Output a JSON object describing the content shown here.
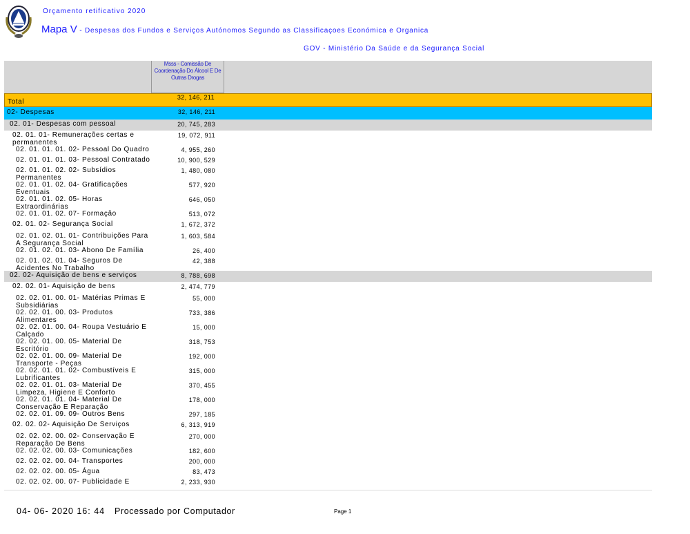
{
  "header": {
    "subtitle": "Orçamento retificativo 2020",
    "title_big": "Mapa V",
    "title_rest": " - Despesas dos Fundos e Serviços Autónomos Segundo as Classificaçoes Económica e Organica",
    "org": "GOV - Ministério Da Saúde e da Segurança Social"
  },
  "table": {
    "column_header": "Msss - Comissão De Coordenação Do Álcool E De Outras Drogas",
    "rows": [
      {
        "label": "Total",
        "value": "32, 146, 211",
        "style": "total"
      },
      {
        "label": "02- Despesas",
        "value": "32, 146, 211",
        "style": "desp"
      },
      {
        "label": "02. 01- Despesas com pessoal",
        "value": "20, 745, 283",
        "style": "grey l1"
      },
      {
        "label": "02. 01. 01- Remunerações certas e permanentes",
        "value": "19, 072, 911",
        "style": "l2 h2"
      },
      {
        "label": "02. 01. 01. 01. 02- Pessoal Do Quadro",
        "value": "4, 955, 260",
        "style": "l3 h1"
      },
      {
        "label": "02. 01. 01. 01. 03- Pessoal Contratado",
        "value": "10, 900, 529",
        "style": "l3 h1"
      },
      {
        "label": "02. 01. 01. 02. 02- Subsídios Permanentes",
        "value": "1, 480, 080",
        "style": "l3 h2"
      },
      {
        "label": "02. 01. 01. 02. 04- Gratificações Eventuais",
        "value": "577, 920",
        "style": "l3 h2"
      },
      {
        "label": "02. 01. 01. 02. 05- Horas Extraordinárias",
        "value": "646, 050",
        "style": "l3 h2"
      },
      {
        "label": "02. 01. 01. 02. 07- Formação",
        "value": "513, 072",
        "style": "l3 h1"
      },
      {
        "label": "02. 01. 02- Segurança Social",
        "value": "1, 672, 372",
        "style": "l2 h1x"
      },
      {
        "label": "02. 01. 02. 01. 01- Contribuições Para A Segurança Social",
        "value": "1, 603, 584",
        "style": "l3 h2"
      },
      {
        "label": "02. 01. 02. 01. 03- Abono De Família",
        "value": "26, 400",
        "style": "l3 h1"
      },
      {
        "label": "02. 01. 02. 01. 04- Seguros De Acidentes No Trabalho",
        "value": "42, 388",
        "style": "l3 h2"
      },
      {
        "label": "02. 02- Aquisição de bens e serviços",
        "value": "8, 788, 698",
        "style": "grey l1"
      },
      {
        "label": "02. 02. 01- Aquisição de bens",
        "value": "2, 474, 779",
        "style": "l2 h1x"
      },
      {
        "label": "02. 02. 01. 00. 01- Matérias Primas E Subsidiárias",
        "value": "55, 000",
        "style": "l3 h2"
      },
      {
        "label": "02. 02. 01. 00. 03- Produtos Alimentares",
        "value": "733, 386",
        "style": "l3 h2"
      },
      {
        "label": "02. 02. 01. 00. 04- Roupa Vestuário E Calçado",
        "value": "15, 000",
        "style": "l3 h2"
      },
      {
        "label": "02. 02. 01. 00. 05- Material De Escritório",
        "value": "318, 753",
        "style": "l3 h2"
      },
      {
        "label": "02. 02. 01. 00. 09- Material De Transporte - Peças",
        "value": "192, 000",
        "style": "l3 h2"
      },
      {
        "label": "02. 02. 01. 01. 02- Combustíveis E Lubrificantes",
        "value": "315, 000",
        "style": "l3 h2"
      },
      {
        "label": "02. 02. 01. 01. 03- Material De Limpeza, Higiene E Conforto",
        "value": "370, 455",
        "style": "l3 h2"
      },
      {
        "label": "02. 02. 01. 01. 04- Material De Conservação E Reparação",
        "value": "178, 000",
        "style": "l3 h2"
      },
      {
        "label": "02. 02. 01. 09. 09- Outros Bens",
        "value": "297, 185",
        "style": "l3 h1"
      },
      {
        "label": "02. 02. 02- Aquisição De Serviços",
        "value": "6, 313, 919",
        "style": "l2 h1x"
      },
      {
        "label": "02. 02. 02. 00. 02- Conservação E Reparação De Bens",
        "value": "270, 000",
        "style": "l3 h2"
      },
      {
        "label": "02. 02. 02. 00. 03- Comunicações",
        "value": "182, 600",
        "style": "l3 h1"
      },
      {
        "label": "02. 02. 02. 00. 04- Transportes",
        "value": "200, 000",
        "style": "l3 h1"
      },
      {
        "label": "02. 02. 02. 00. 05- Água",
        "value": "83, 473",
        "style": "l3 h1"
      },
      {
        "label": "02. 02. 02. 00. 07- Publicidade E",
        "value": "2, 233, 930",
        "style": "l3 h1"
      }
    ]
  },
  "footer": {
    "datetime": "04- 06- 2020 16: 44",
    "processed": "Processado por Computador",
    "page": "Page 1"
  }
}
